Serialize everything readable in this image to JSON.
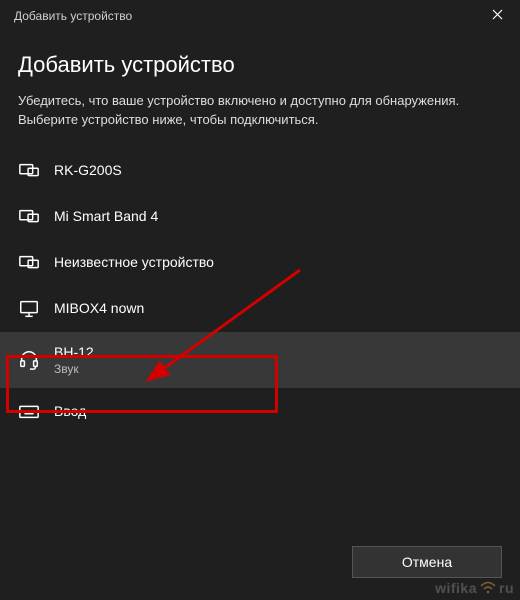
{
  "window": {
    "title": "Добавить устройство",
    "close_label": "Close"
  },
  "heading": "Добавить устройство",
  "subtext": "Убедитесь, что ваше устройство включено и доступно для обнаружения. Выберите устройство ниже, чтобы подключиться.",
  "devices": [
    {
      "icon": "display",
      "name": "RK-G200S",
      "sub": "",
      "selected": false
    },
    {
      "icon": "display",
      "name": "Mi Smart Band 4",
      "sub": "",
      "selected": false
    },
    {
      "icon": "display",
      "name": "Неизвестное устройство",
      "sub": "",
      "selected": false
    },
    {
      "icon": "monitor",
      "name": "MIBOX4 nown",
      "sub": "",
      "selected": false
    },
    {
      "icon": "headset",
      "name": "BH-12",
      "sub": "Звук",
      "selected": true
    },
    {
      "icon": "keyboard",
      "name": "Ввод",
      "sub": "",
      "selected": false
    }
  ],
  "footer": {
    "cancel": "Отмена"
  },
  "watermark": {
    "left": "wifika",
    "right": "ru"
  },
  "annotation": {
    "highlight_device_index": 4,
    "arrow_color": "#d40000"
  }
}
